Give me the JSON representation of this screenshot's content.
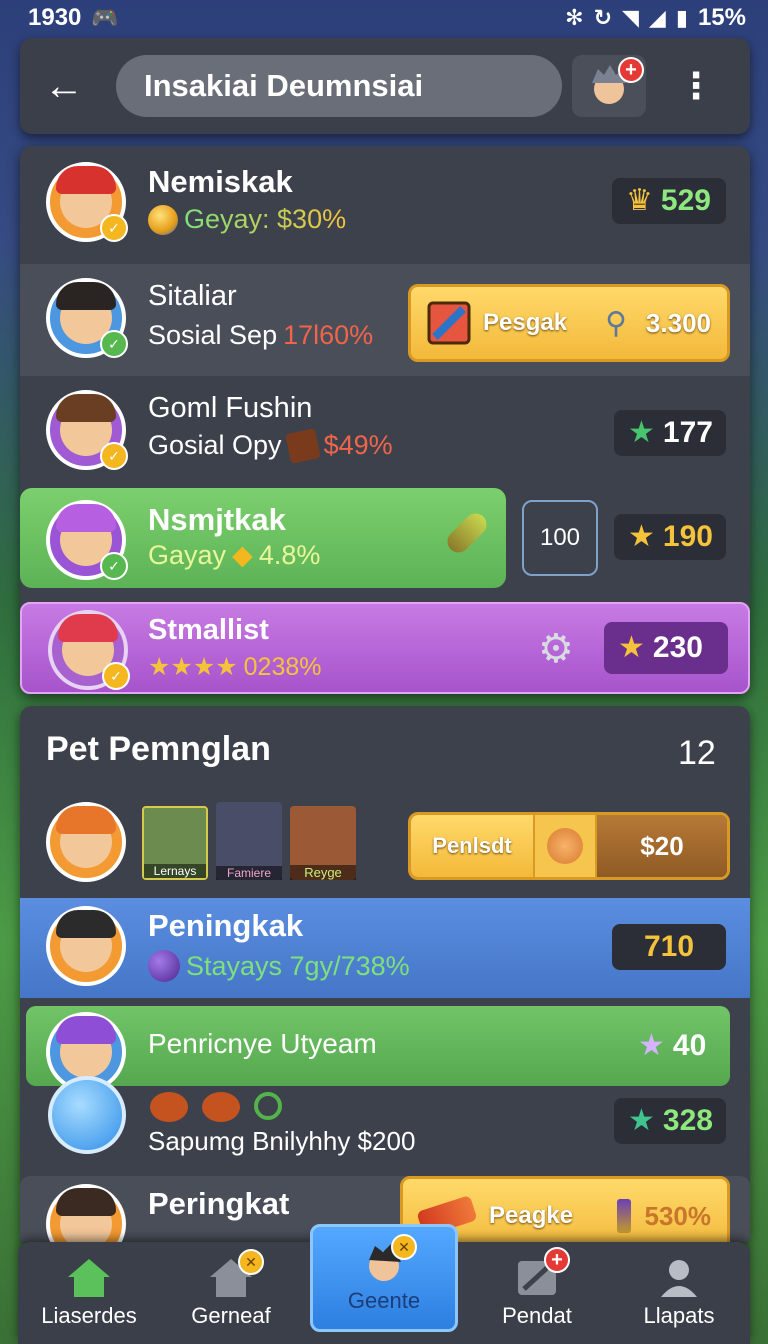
{
  "status": {
    "time": "1930",
    "battery": "15%"
  },
  "header": {
    "title": "Insakiai Deumnsiai"
  },
  "rows": [
    {
      "name": "Nemiskak",
      "sub": "Geyay: $30%",
      "score": "529"
    },
    {
      "name": "Sitaliar",
      "sub_a": "Sosial Sep",
      "sub_b": "17l60%",
      "btn_label": "Pesgak",
      "btn_value": "3.300"
    },
    {
      "name": "Goml Fushin",
      "sub_a": "Gosial Opy",
      "sub_b": "$49%",
      "score": "177"
    },
    {
      "name": "Nsmjtkak",
      "sub_a": "Gayay",
      "sub_b": "4.8%",
      "box": "100",
      "score": "190"
    },
    {
      "name": "Stmallist",
      "sub_stars": "★★★★",
      "sub_b": "0238%",
      "score": "230"
    }
  ],
  "section2": {
    "title": "Pet Pemnglan",
    "count": "12",
    "pets": [
      "Lernays",
      "Famiere",
      "Reyge"
    ],
    "seg_left": "Penlsdt",
    "seg_right": "$20",
    "row_a": {
      "name": "Peningkak",
      "sub": "Stayays 7gy/738%",
      "score": "710"
    },
    "row_b": {
      "name": "Penricnye Utyeam",
      "score": "40"
    },
    "row_c": {
      "sub": "Sapumg Bnilyhhy $200",
      "score": "328"
    },
    "row_d": {
      "name": "Peringkat",
      "btn_label": "Peagke",
      "btn_value": "530%"
    }
  },
  "nav": [
    {
      "label": "Liaserdes",
      "icon": "home-icon"
    },
    {
      "label": "Gerneaf",
      "icon": "house-icon"
    },
    {
      "label": "Geente",
      "icon": "avatar-icon"
    },
    {
      "label": "Pendat",
      "icon": "tool-icon"
    },
    {
      "label": "Llapats",
      "icon": "user-icon"
    }
  ],
  "colors": {
    "green": "#6ec46a",
    "purple": "#b45ed8",
    "blue": "#4d7fd0",
    "gold": "#f5bf3c"
  }
}
